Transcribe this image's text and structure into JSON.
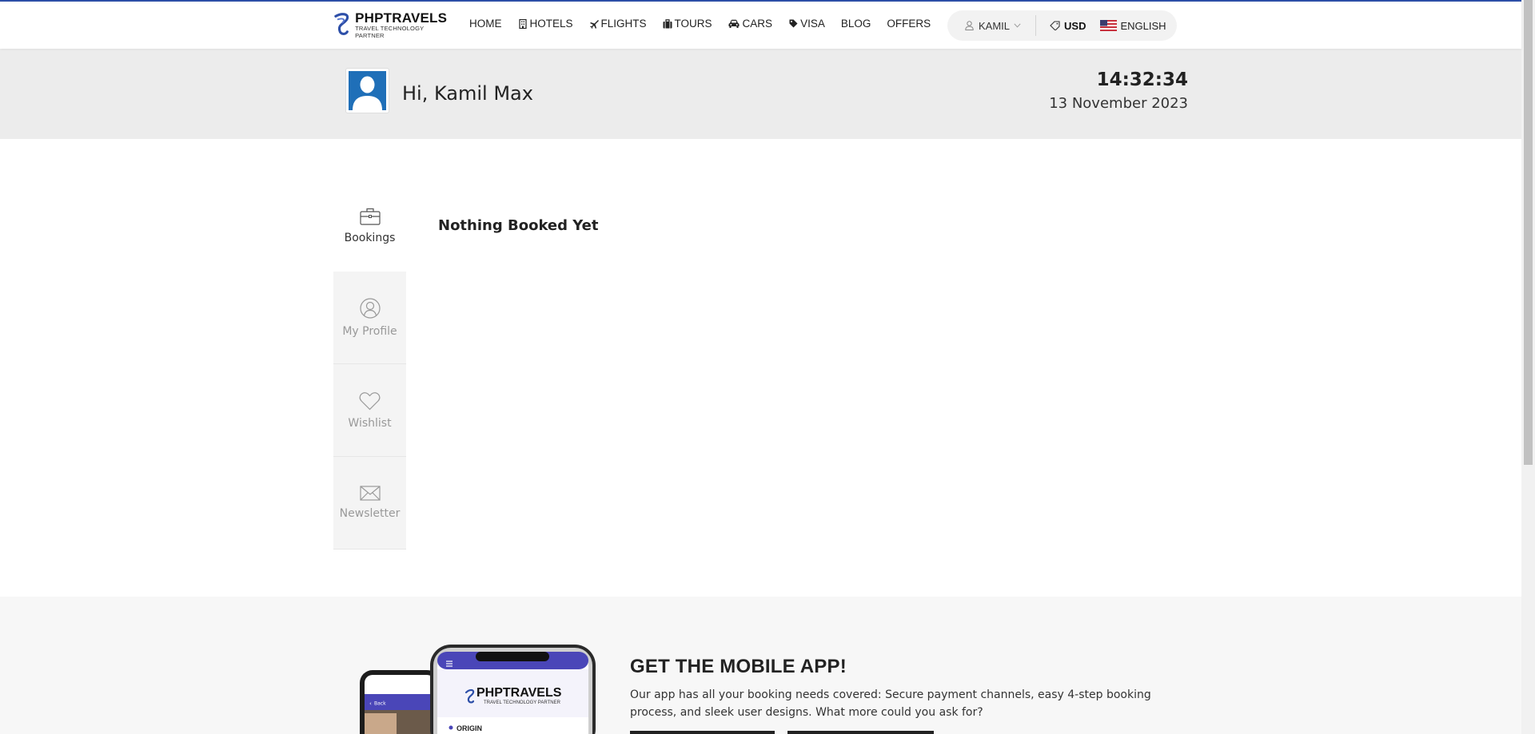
{
  "header": {
    "logo": {
      "name": "PHPTRAVELS",
      "tagline": "TRAVEL TECHNOLOGY PARTNER"
    },
    "nav": [
      {
        "label": "HOME",
        "icon": ""
      },
      {
        "label": "HOTELS",
        "icon": "building-icon"
      },
      {
        "label": "FLIGHTS",
        "icon": "plane-icon"
      },
      {
        "label": "TOURS",
        "icon": "suitcase-icon"
      },
      {
        "label": "CARS",
        "icon": "car-icon"
      },
      {
        "label": "VISA",
        "icon": "tag-icon"
      },
      {
        "label": "BLOG",
        "icon": ""
      },
      {
        "label": "OFFERS",
        "icon": ""
      }
    ],
    "user_menu": "KAMIL",
    "currency": "USD",
    "language": "ENGLISH"
  },
  "welcome": {
    "greeting": "Hi, Kamil Max",
    "time": "14:32:34",
    "date": "13 November 2023"
  },
  "dashboard": {
    "tabs": [
      {
        "label": "Bookings",
        "icon": "briefcase-icon",
        "active": true
      },
      {
        "label": "My Profile",
        "icon": "user-icon",
        "active": false
      },
      {
        "label": "Wishlist",
        "icon": "heart-icon",
        "active": false
      },
      {
        "label": "Newsletter",
        "icon": "envelope-icon",
        "active": false
      }
    ],
    "content_title": "Nothing Booked Yet"
  },
  "promo": {
    "title": "GET THE MOBILE APP!",
    "description": "Our app has all your booking needs covered: Secure payment channels, easy 4-step booking process, and sleek user designs. What more could you ask for?",
    "phone_logo": "PHPTRAVELS",
    "phone_tagline": "TRAVEL TECHNOLOGY PARTNER",
    "phone_back": "Back",
    "phone_field": "ORIGIN"
  },
  "colors": {
    "brand": "#2d4fa8",
    "avatar": "#1f6fb8",
    "band": "#ececec"
  }
}
